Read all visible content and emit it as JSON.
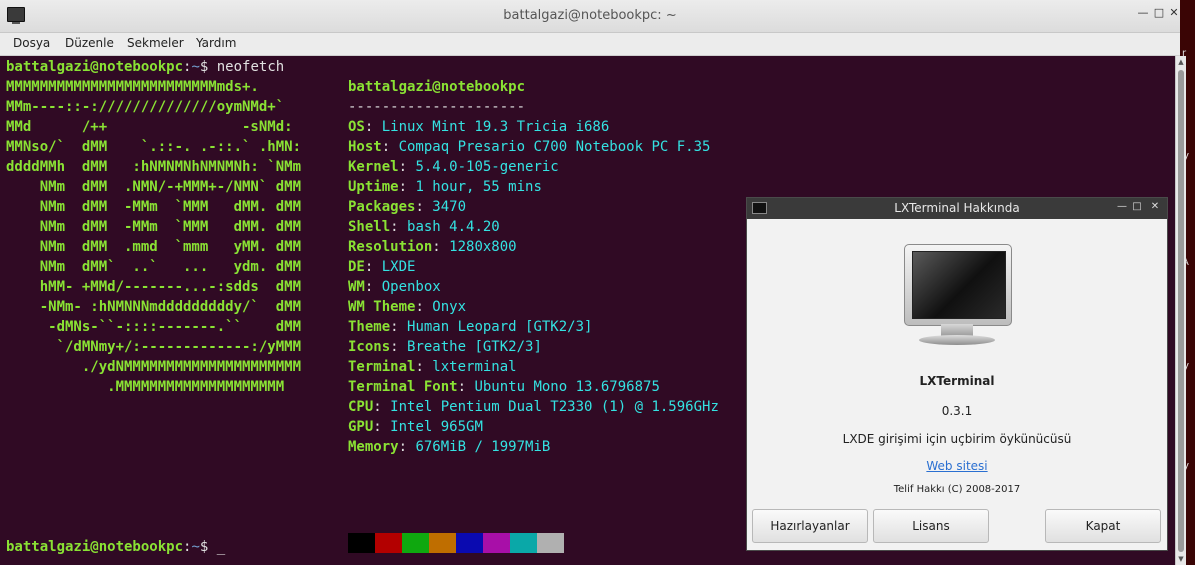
{
  "window": {
    "title": "battalgazi@notebookpc: ~"
  },
  "menu": {
    "items": [
      "Dosya",
      "Düzenle",
      "Sekmeler",
      "Yardım"
    ]
  },
  "terminal": {
    "prompt": {
      "user": "battalgazi@notebookpc",
      "sep": ":",
      "path": "~",
      "dollar": "$ ",
      "command": "neofetch"
    },
    "logo": [
      "MMMMMMMMMMMMMMMMMMMMMMMMMmds+.",
      "MMm----::-://////////////oymNMd+`",
      "MMd      /++                -sNMd:",
      "MMNso/`  dMM    `.::-. .-::.` .hMN:",
      "ddddMMh  dMM   :hNMNMNhNMNMNh: `NMm",
      "    NMm  dMM  .NMN/-+MMM+-/NMN` dMM",
      "    NMm  dMM  -MMm  `MMM   dMM. dMM",
      "    NMm  dMM  -MMm  `MMM   dMM. dMM",
      "    NMm  dMM  .mmd  `mmm   yMM. dMM",
      "    NMm  dMM`  ..`   ...   ydm. dMM",
      "    hMM- +MMd/-------...-:sdds  dMM",
      "    -NMm- :hNMNNNmdddddddddy/`  dMM",
      "     -dMNs-``-::::-------.``    dMM",
      "      `/dMNmy+/:-------------:/yMMM",
      "         ./ydNMMMMMMMMMMMMMMMMMMMMM",
      "            .MMMMMMMMMMMMMMMMMMMM"
    ],
    "header": "battalgazi@notebookpc",
    "divider": "---------------------",
    "info": [
      {
        "key": "OS",
        "value": "Linux Mint 19.3 Tricia i686"
      },
      {
        "key": "Host",
        "value": "Compaq Presario C700 Notebook PC F.35"
      },
      {
        "key": "Kernel",
        "value": "5.4.0-105-generic"
      },
      {
        "key": "Uptime",
        "value": "1 hour, 55 mins"
      },
      {
        "key": "Packages",
        "value": "3470"
      },
      {
        "key": "Shell",
        "value": "bash 4.4.20"
      },
      {
        "key": "Resolution",
        "value": "1280x800"
      },
      {
        "key": "DE",
        "value": "LXDE"
      },
      {
        "key": "WM",
        "value": "Openbox"
      },
      {
        "key": "WM Theme",
        "value": "Onyx"
      },
      {
        "key": "Theme",
        "value": "Human Leopard [GTK2/3]"
      },
      {
        "key": "Icons",
        "value": "Breathe [GTK2/3]"
      },
      {
        "key": "Terminal",
        "value": "lxterminal"
      },
      {
        "key": "Terminal Font",
        "value": "Ubuntu Mono 13.6796875"
      },
      {
        "key": "CPU",
        "value": "Intel Pentium Dual T2330 (1) @ 1.596GHz"
      },
      {
        "key": "GPU",
        "value": "Intel 965GM"
      },
      {
        "key": "Memory",
        "value": "676MiB / 1997MiB"
      }
    ],
    "colors": [
      "#000000",
      "#b30000",
      "#0fa80f",
      "#bf6e00",
      "#0a0ab0",
      "#a80fa8",
      "#0aa8a8",
      "#b0b0b0"
    ],
    "cursor": "_"
  },
  "about": {
    "title": "LXTerminal Hakkında",
    "app_name": "LXTerminal",
    "version": "0.3.1",
    "description": "LXDE girişimi için uçbirim öykünücüsü",
    "website": "Web sitesi",
    "copyright": "Telif Hakkı (C) 2008-2017",
    "buttons": {
      "credits": "Hazırlayanlar",
      "license": "Lisans",
      "close": "Kapat"
    }
  },
  "desktop": {
    "letters": [
      "r",
      "V",
      "A",
      "V",
      "V"
    ]
  }
}
